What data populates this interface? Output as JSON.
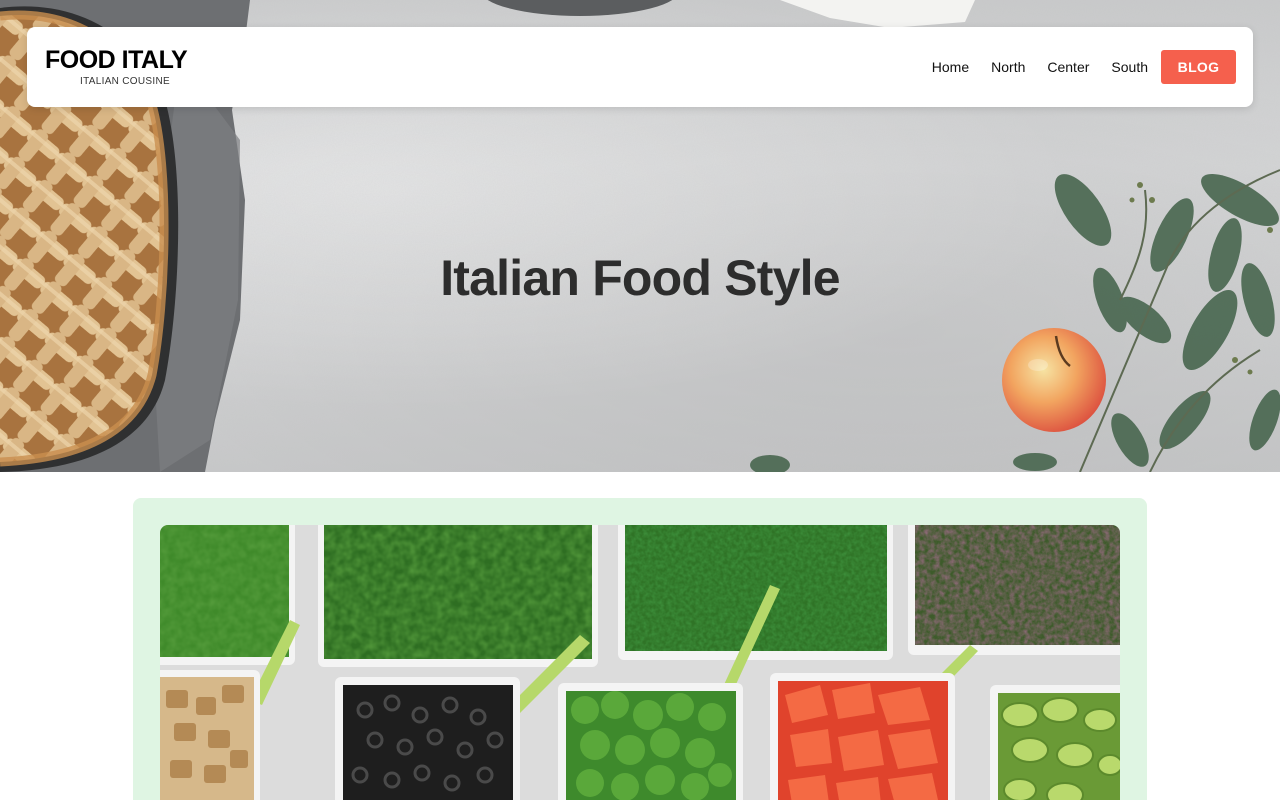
{
  "navbar": {
    "brand_name": "FOOD ITALY",
    "brand_subtitle": "ITALIAN COUSINE",
    "links": [
      "Home",
      "North",
      "Center",
      "South"
    ],
    "cta_label": "BLOG"
  },
  "hero": {
    "title": "Italian Food Style"
  },
  "colors": {
    "accent": "#f5604d",
    "card_background": "#dff5e3",
    "title_text": "#2d2d2d"
  }
}
